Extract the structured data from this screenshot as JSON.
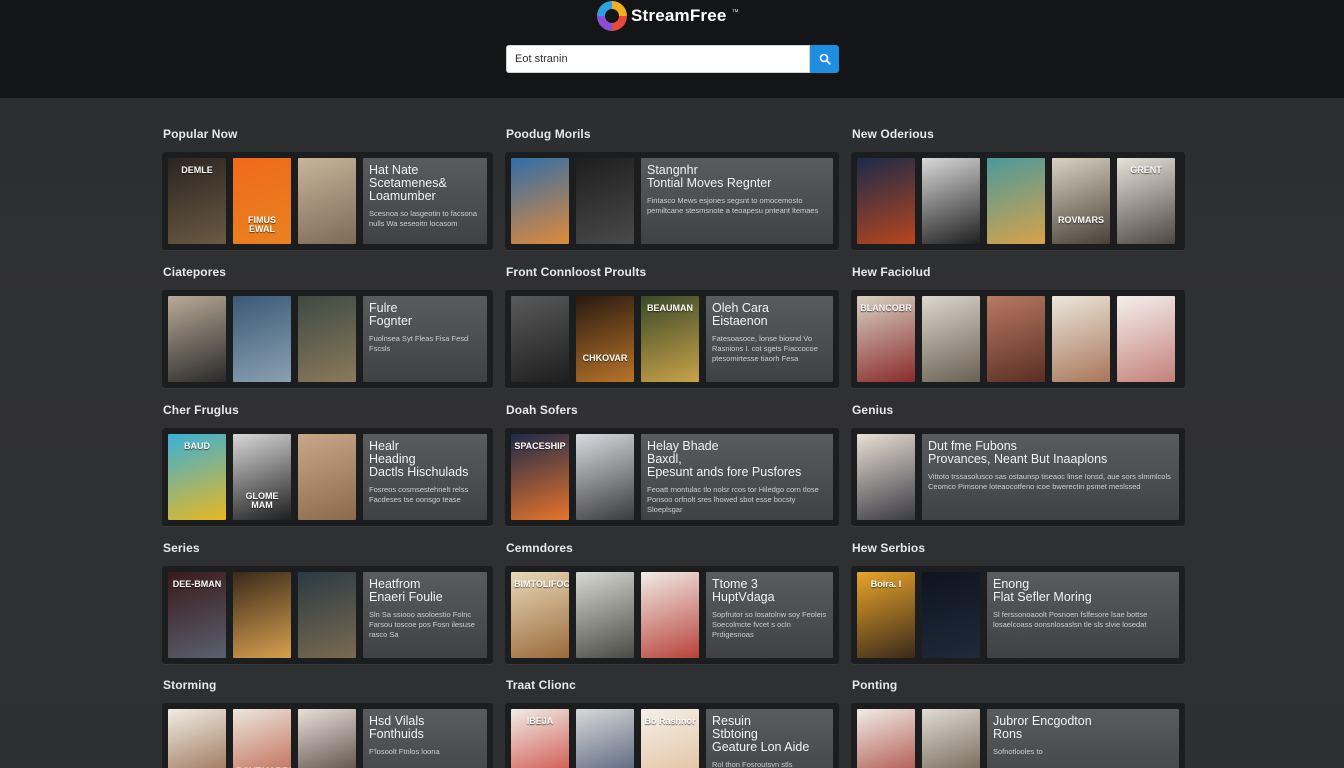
{
  "header": {
    "brand": "StreamFree",
    "brand_mark": "™",
    "search_value": "Eot stranin"
  },
  "sections": [
    {
      "title": "Popular Now",
      "posters": [
        {
          "color1": "#2b2420",
          "color2": "#6a5a44",
          "text": "DEMLE"
        },
        {
          "color1": "#f06a1c",
          "color2": "#e8821e",
          "text": "FIMUS\nEWAL"
        },
        {
          "color1": "#c9b49a",
          "color2": "#7d6a57",
          "text": ""
        }
      ],
      "info": {
        "title": "Hat Nate\nScetamenes&\nLoamumber",
        "desc": "Scesnoa so lasgeotin to facsona nulls Wa seseoitn locasom"
      }
    },
    {
      "title": "Poodug Morils",
      "posters": [
        {
          "color1": "#2f6ea8",
          "color2": "#e08a3a",
          "text": ""
        },
        {
          "color1": "#1e1e1e",
          "color2": "#4a4a4a",
          "text": ""
        }
      ],
      "info": {
        "title": "Stangnhr\nTontial Moves Regnter",
        "desc": "Fintasco Mews esjones segsnt to omocemosto pemiltcane stesmsnote a teoapesu pnteant ltemaes"
      }
    },
    {
      "title": "New Oderious",
      "posters": [
        {
          "color1": "#1b2a4a",
          "color2": "#b8461e",
          "text": ""
        },
        {
          "color1": "#d8d8d8",
          "color2": "#202020",
          "text": ""
        },
        {
          "color1": "#4a9a9a",
          "color2": "#d8a24a",
          "text": ""
        },
        {
          "color1": "#d9d2c4",
          "color2": "#4a4036",
          "text": "ROVMARS"
        },
        {
          "color1": "#e6e2da",
          "color2": "#4c4740",
          "text": "GRENT"
        }
      ],
      "info": null
    },
    {
      "title": "Ciatepores",
      "posters": [
        {
          "color1": "#b8aa98",
          "color2": "#2a2a2a",
          "text": ""
        },
        {
          "color1": "#3a5a78",
          "color2": "#8aa0b0",
          "text": ""
        },
        {
          "color1": "#3e4a44",
          "color2": "#8a7a5a",
          "text": ""
        }
      ],
      "info": {
        "title": "Fulre\nFognter",
        "desc": "Fuolnsea Syt Fleas Fisa Fesd Fscsls"
      }
    },
    {
      "title": "Front Connloost Proults",
      "posters": [
        {
          "color1": "#5a5a5a",
          "color2": "#1e1e1e",
          "text": ""
        },
        {
          "color1": "#2a1a10",
          "color2": "#b8742a",
          "text": "CHKOVAR"
        },
        {
          "color1": "#3a4a28",
          "color2": "#c9a24a",
          "text": "BEAUMAN"
        }
      ],
      "info": {
        "title": "Oleh Cara\nEistaenon",
        "desc": "Fatesoasoce, lonse biosnd Vo Rasnions I. cot sgets Fiaccocoe ptesomirtesse tiaorh Fesa"
      }
    },
    {
      "title": "Hew Faciolud",
      "posters": [
        {
          "color1": "#d8d2c4",
          "color2": "#8a2a2a",
          "text": "BLANCOBR"
        },
        {
          "color1": "#dcd6cc",
          "color2": "#6a6054",
          "text": ""
        },
        {
          "color1": "#b87a62",
          "color2": "#5a2e24",
          "text": ""
        },
        {
          "color1": "#ece6dc",
          "color2": "#a8765a",
          "text": ""
        },
        {
          "color1": "#f4f0ec",
          "color2": "#c4807a",
          "text": ""
        }
      ],
      "info": null
    },
    {
      "title": "Cher Fruglus",
      "posters": [
        {
          "color1": "#3ab0d8",
          "color2": "#e8b820",
          "text": "BAUD"
        },
        {
          "color1": "#d8d8d8",
          "color2": "#1e1e1e",
          "text": "GLOME MAM"
        },
        {
          "color1": "#c8a888",
          "color2": "#8a6a4a",
          "text": ""
        }
      ],
      "info": {
        "title": "Healr\nHeading\nDactls Hischulads",
        "desc": "Fosreos cosmsestehnelt relss Facdeses tse oonsgo tease"
      }
    },
    {
      "title": "Doah Sofers",
      "posters": [
        {
          "color1": "#1e2a4a",
          "color2": "#e8742a",
          "text": "SPACESHIP"
        },
        {
          "color1": "#d8dce0",
          "color2": "#3a3a3a",
          "text": ""
        }
      ],
      "info": {
        "title": "Helay Bhade\nBaxdl,\nEpesunt ands fore Pusfores",
        "desc": "Feoatt rnontulac tlo nolsr rcos tor Hiledgo corn tlose Ponsoo orfnolt sres lhowed sbot esse bocsty Sloeplsgar"
      }
    },
    {
      "title": "Genius",
      "posters": [
        {
          "color1": "#e8e0d4",
          "color2": "#3a3a44",
          "text": ""
        }
      ],
      "info": {
        "title": "Dut fme Fubons\nProvances, Neant But Inaaplons",
        "desc": "Vittoto trssasolusco sas ostaunsp tiseaoc linse Ionsd, aue sors slmmlcols Ceomco Pimsone loteaocotfeno icoe bwerectin psmet meslssed"
      }
    },
    {
      "title": "Series",
      "posters": [
        {
          "color1": "#3a1a1a",
          "color2": "#5a6070",
          "text": "DEE-BMAN"
        },
        {
          "color1": "#3a2a1a",
          "color2": "#d8a050",
          "text": ""
        },
        {
          "color1": "#2a3a44",
          "color2": "#7a6a50",
          "text": ""
        }
      ],
      "info": {
        "title": "Heatfrom\nEnaeri Foulie",
        "desc": "Sln Sa ssiooo asoloestio Folnc Farsou toscoe pos Fosn ilesuse rasco Sa"
      }
    },
    {
      "title": "Cemndores",
      "posters": [
        {
          "color1": "#e8d8b8",
          "color2": "#9a6a3a",
          "text": "BIMTOLIFOCH"
        },
        {
          "color1": "#d8d8d4",
          "color2": "#4a4a44",
          "text": ""
        },
        {
          "color1": "#f0ece6",
          "color2": "#b8423a",
          "text": ""
        }
      ],
      "info": {
        "title": "Ttome 3\nHuptVdaga",
        "desc": "Sopfrutor so losatolnw soy Feoleis Soecolmcte fvcet s ocln Prdigesnoas"
      }
    },
    {
      "title": "Hew Serbios",
      "posters": [
        {
          "color1": "#e8a42a",
          "color2": "#3a2a1a",
          "text": "Boira. I"
        },
        {
          "color1": "#0e1420",
          "color2": "#1e2a3a",
          "text": ""
        }
      ],
      "info": {
        "title": "Enong\nFlat Sefler Moring",
        "desc": "Sl ferssonoaoolt Posnoen fslfesore lsae bottse losaelcoass oonsnlosaslsn tle sls slvie losedat"
      }
    },
    {
      "title": "Storming",
      "posters": [
        {
          "color1": "#f0ece4",
          "color2": "#8a5a3a",
          "text": ""
        },
        {
          "color1": "#ece6dc",
          "color2": "#b8523a",
          "text": "ROVEMARES"
        },
        {
          "color1": "#e8e0d8",
          "color2": "#3a2a24",
          "text": ""
        }
      ],
      "info": {
        "title": "Hsd Vilals\nFonthuids",
        "desc": "F'losoolt Ftnlos loona"
      }
    },
    {
      "title": "Traat Clionc",
      "posters": [
        {
          "color1": "#f0ece6",
          "color2": "#c8342a",
          "text": "IBEJA"
        },
        {
          "color1": "#d8d8d8",
          "color2": "#3a4a6a",
          "text": ""
        },
        {
          "color1": "#f4f0ea",
          "color2": "#e0b890",
          "text": "Bo Rashnor"
        }
      ],
      "info": {
        "title": "Resuin\nStbtoing\nGeature Lon Aide",
        "desc": "Rol thon Fosroutsvn stls"
      }
    },
    {
      "title": "Ponting",
      "posters": [
        {
          "color1": "#f0ece6",
          "color2": "#a0342a",
          "text": ""
        },
        {
          "color1": "#e0dcd4",
          "color2": "#5a4a3a",
          "text": ""
        }
      ],
      "info": {
        "title": "Jubror Encgodton\nRons",
        "desc": "Sofnotlooles to"
      }
    }
  ]
}
